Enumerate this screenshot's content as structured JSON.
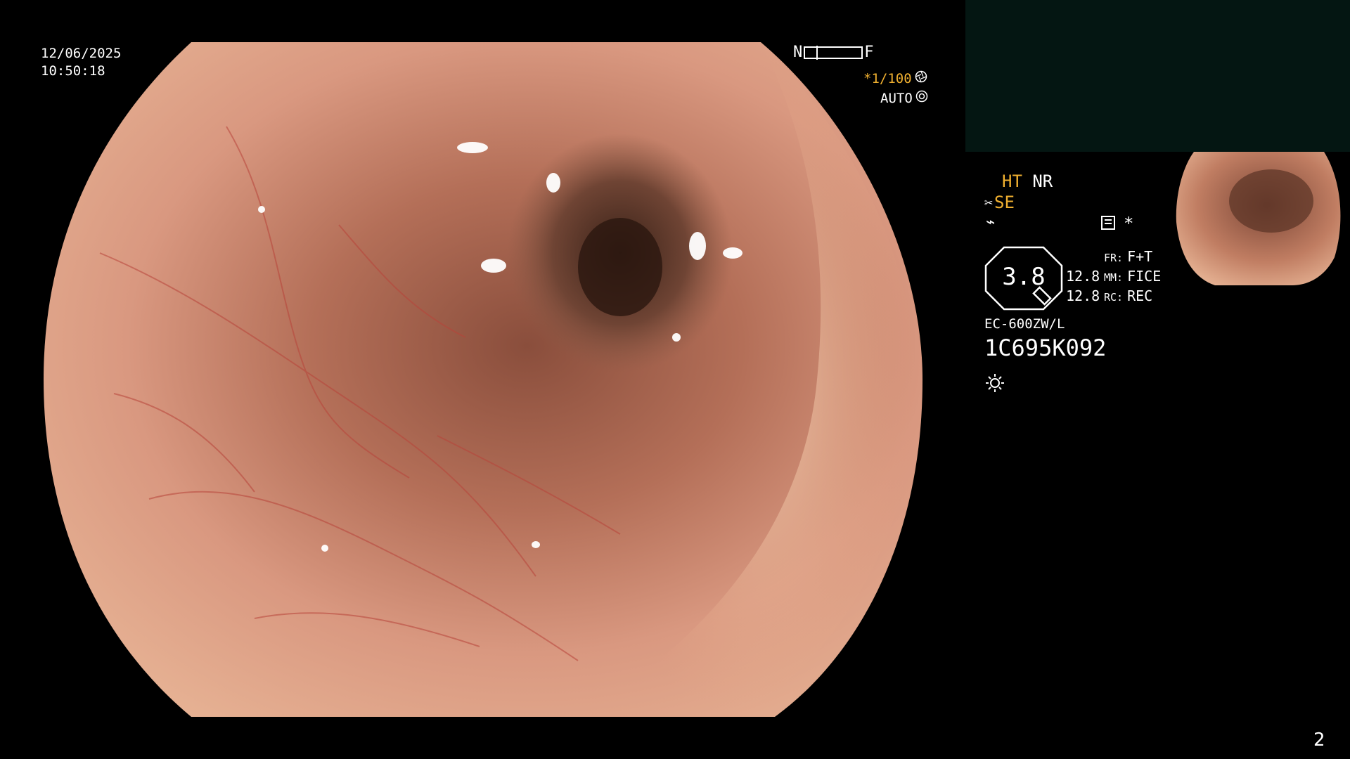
{
  "datetime": {
    "date": "12/06/2025",
    "time": "10:50:18"
  },
  "focus_scale": {
    "near_label": "N",
    "far_label": "F"
  },
  "exposure": {
    "shutter": "*1/100",
    "mode": "AUTO"
  },
  "image_modes": {
    "ht": "HT",
    "nr": "NR",
    "se": "SE"
  },
  "gauge": {
    "value": "3.8"
  },
  "params": {
    "rows": [
      {
        "num": "",
        "key": "FR:",
        "val": "F+T"
      },
      {
        "num": "12.8",
        "key": "MM:",
        "val": "FICE"
      },
      {
        "num": "12.8",
        "key": "RC:",
        "val": "REC"
      }
    ]
  },
  "scope_model": "EC-600ZW/L",
  "scope_serial": "1C695K092",
  "page_number": "2",
  "icons": {
    "shutter": "aperture-icon",
    "auto": "iris-icon",
    "scissors": "cut-icon",
    "freeze": "freeze-icon",
    "memory": "memory-card-icon",
    "asterisk": "asterisk-icon",
    "light": "light-source-icon"
  },
  "colors": {
    "accent": "#f0b030",
    "text": "#ffffff",
    "background": "#000000",
    "thumb_panel": "#041612"
  }
}
